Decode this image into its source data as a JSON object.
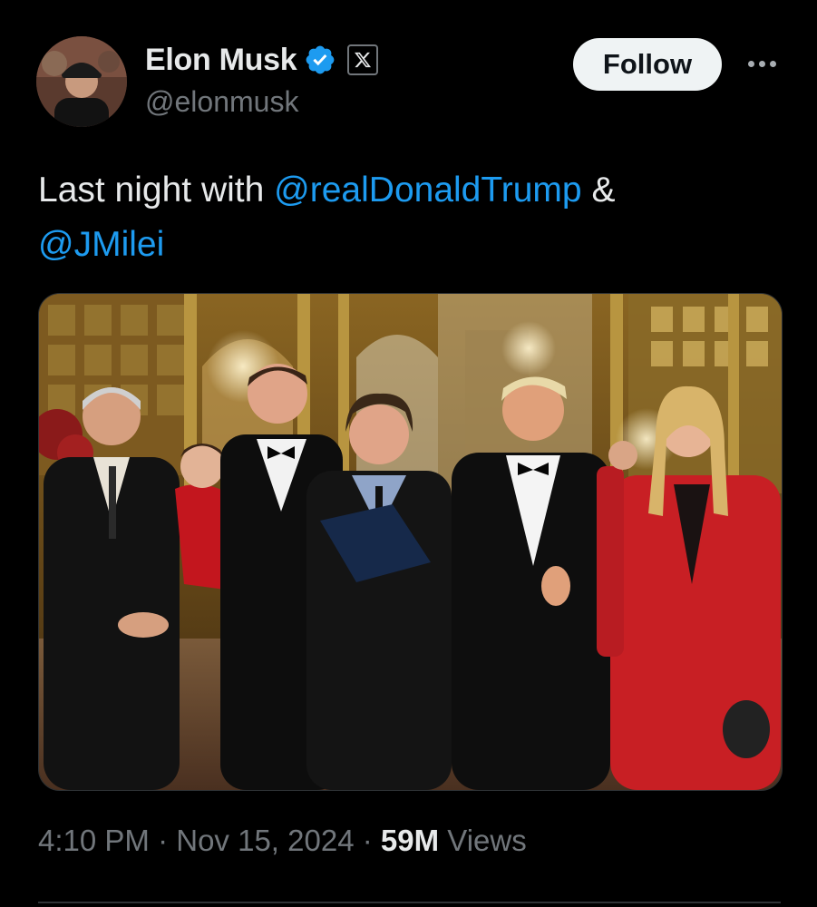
{
  "author": {
    "display_name": "Elon Musk",
    "handle": "@elonmusk",
    "verified_icon": "verified-badge-icon",
    "affiliation_icon": "x-logo-icon",
    "avatar": "avatar"
  },
  "actions": {
    "follow_label": "Follow",
    "more_icon": "more-icon"
  },
  "tweet": {
    "text_prefix": "Last night with ",
    "mention_1": "@realDonaldTrump",
    "text_middle": " &",
    "mention_2": "@JMilei"
  },
  "meta": {
    "time": "4:10 PM",
    "separator": "·",
    "date": "Nov 15, 2024",
    "views_count": "59M",
    "views_label": "Views"
  },
  "colors": {
    "background": "#000000",
    "text": "#e7e9ea",
    "secondary_text": "#71767b",
    "link": "#1d9bf0",
    "verified": "#1d9bf0",
    "follow_button_bg": "#eff3f4"
  }
}
